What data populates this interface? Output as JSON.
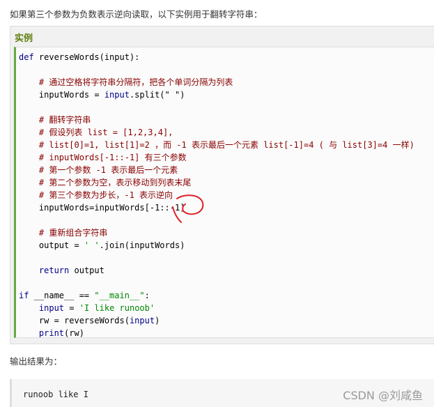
{
  "intro_text": "如果第三个参数为负数表示逆向读取，以下实例用于翻转字符串：",
  "example": {
    "title": "实例",
    "code_lines": [
      [
        {
          "t": "def ",
          "c": "kw"
        },
        {
          "t": "reverseWords(input):",
          "c": "pl"
        }
      ],
      [],
      [
        {
          "t": "    # 通过空格将字符串分隔符，把各个单词分隔为列表",
          "c": "cm"
        }
      ],
      [
        {
          "t": "    inputWords = ",
          "c": "pl"
        },
        {
          "t": "input",
          "c": "kw"
        },
        {
          "t": ".split(\" \")",
          "c": "pl"
        }
      ],
      [],
      [
        {
          "t": "    # 翻转字符串",
          "c": "cm"
        }
      ],
      [
        {
          "t": "    # 假设列表 list = [1,2,3,4],",
          "c": "cm"
        }
      ],
      [
        {
          "t": "    # list[0]=1, list[1]=2 ，而 -1 表示最后一个元素 list[-1]=4 ( 与 list[3]=4 一样)",
          "c": "cm"
        }
      ],
      [
        {
          "t": "    # inputWords[-1::-1] 有三个参数",
          "c": "cm"
        }
      ],
      [
        {
          "t": "    # 第一个参数 -1 表示最后一个元素",
          "c": "cm"
        }
      ],
      [
        {
          "t": "    # 第二个参数为空，表示移动到列表末尾",
          "c": "cm"
        }
      ],
      [
        {
          "t": "    # 第三个参数为步长，-1 表示逆向",
          "c": "cm"
        }
      ],
      [
        {
          "t": "    inputWords=inputWords[-1::-1]",
          "c": "pl"
        }
      ],
      [],
      [
        {
          "t": "    # 重新组合字符串",
          "c": "cm"
        }
      ],
      [
        {
          "t": "    output = ",
          "c": "pl"
        },
        {
          "t": "' '",
          "c": "str"
        },
        {
          "t": ".join(inputWords)",
          "c": "pl"
        }
      ],
      [],
      [
        {
          "t": "    ",
          "c": "pl"
        },
        {
          "t": "return",
          "c": "kw"
        },
        {
          "t": " output",
          "c": "pl"
        }
      ],
      [],
      [
        {
          "t": "if",
          "c": "kw"
        },
        {
          "t": " __name__ == ",
          "c": "pl"
        },
        {
          "t": "\"__main__\"",
          "c": "str"
        },
        {
          "t": ":",
          "c": "pl"
        }
      ],
      [
        {
          "t": "    ",
          "c": "pl"
        },
        {
          "t": "input",
          "c": "kw"
        },
        {
          "t": " = ",
          "c": "pl"
        },
        {
          "t": "'I like runoob'",
          "c": "str"
        }
      ],
      [
        {
          "t": "    rw = reverseWords(",
          "c": "pl"
        },
        {
          "t": "input",
          "c": "kw"
        },
        {
          "t": ")",
          "c": "pl"
        }
      ],
      [
        {
          "t": "    ",
          "c": "pl"
        },
        {
          "t": "print",
          "c": "kw"
        },
        {
          "t": "(rw)",
          "c": "pl"
        }
      ]
    ]
  },
  "output_label": "输出结果为：",
  "output_text": "runoob like I",
  "watermark": "CSDN @刘咸鱼",
  "colors": {
    "example_title": "#617f10",
    "code_border": "#64ab44",
    "keyword": "#000088",
    "string": "#008800",
    "comment": "#880000",
    "annotation": "#e0202a"
  }
}
